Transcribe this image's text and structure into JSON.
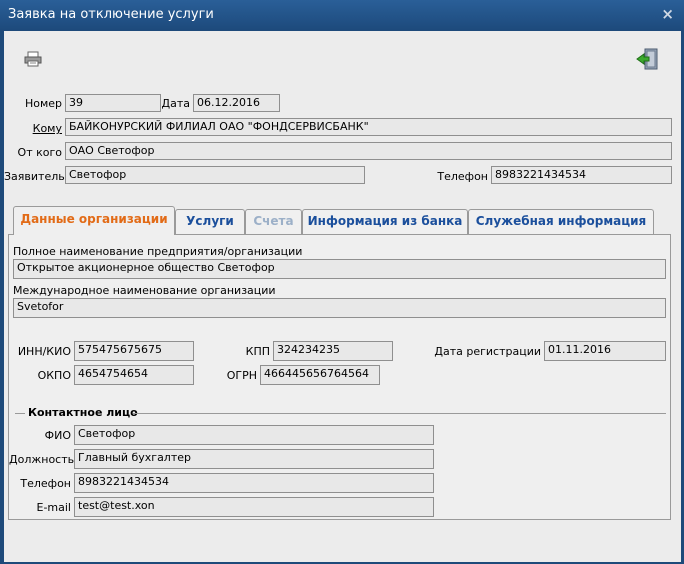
{
  "window": {
    "title": "Заявка на отключение услуги",
    "close": "×"
  },
  "toolbar": {
    "print_icon": "printer-icon",
    "exit_icon": "exit-door-icon"
  },
  "header": {
    "number_label": "Номер",
    "number_value": "39",
    "date_label": "Дата",
    "date_value": "06.12.2016",
    "to_label": "Кому",
    "to_value": "БАЙКОНУРСКИЙ ФИЛИАЛ ОАО \"ФОНДСЕРВИСБАНК\"",
    "from_label": "От кого",
    "from_value": "ОАО Светофор",
    "applicant_label": "Заявитель",
    "applicant_value": "Светофор",
    "phone_label": "Телефон",
    "phone_value": "8983221434534"
  },
  "tabs": [
    {
      "label": "Данные организации",
      "state": "active"
    },
    {
      "label": "Услуги",
      "state": "normal"
    },
    {
      "label": "Счета",
      "state": "disabled"
    },
    {
      "label": "Информация из банка",
      "state": "normal"
    },
    {
      "label": "Служебная информация",
      "state": "normal"
    }
  ],
  "org": {
    "full_name_label": "Полное наименование предприятия/организации",
    "full_name_value": "Открытое акционерное общество Светофор",
    "intl_name_label": "Международное наименование организации",
    "intl_name_value": "Svetofor",
    "inn_label": "ИНН/КИО",
    "inn_value": "575475675675",
    "kpp_label": "КПП",
    "kpp_value": "324234235",
    "reg_date_label": "Дата регистрации",
    "reg_date_value": "01.11.2016",
    "okpo_label": "ОКПО",
    "okpo_value": "4654754654",
    "ogrn_label": "ОГРН",
    "ogrn_value": "466445656764564"
  },
  "contact": {
    "section_label": "Контактное лицо",
    "fio_label": "ФИО",
    "fio_value": "Светофор",
    "position_label": "Должность",
    "position_value": "Главный бухгалтер",
    "phone_label": "Телефон",
    "phone_value": "8983221434534",
    "email_label": "E-mail",
    "email_value": "test@test.xon"
  },
  "colors": {
    "titlebar": "#1e4a7a",
    "active_tab": "#e26b17",
    "tab_text": "#1b4f9c",
    "disabled_tab": "#9cb0c8"
  }
}
